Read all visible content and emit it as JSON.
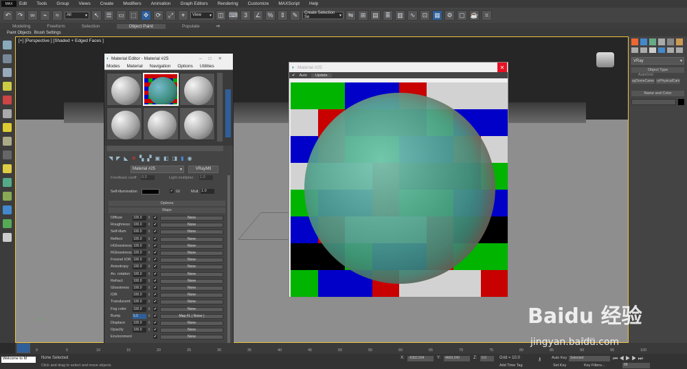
{
  "menubar": {
    "logo": "MAX",
    "items": [
      "Edit",
      "Tools",
      "Group",
      "Views",
      "Create",
      "Modifiers",
      "Animation",
      "Graph Editors",
      "Rendering",
      "Customize",
      "MAXScript",
      "Help"
    ]
  },
  "toolbar": {
    "filter_select": "All",
    "view_select": "View",
    "named_selection": "Create Selection Se"
  },
  "ribbon": {
    "tabs": [
      "Modeling",
      "Freeform",
      "Selection",
      "Object Paint",
      "Populate"
    ],
    "active": "Object Paint",
    "sub": [
      "Paint Objects",
      "Brush Settings"
    ]
  },
  "viewport": {
    "label": "[+] [Perspective ] [Shaded + Edged Faces ]"
  },
  "material_editor": {
    "title": "Material Editor - Material #25",
    "menus": [
      "Modes",
      "Material",
      "Navigation",
      "Options",
      "Utilities"
    ],
    "material_name": "Material #25",
    "material_type": "VRayMtl",
    "fresnel_label": "Feedback coeff",
    "fresnel_value": "0.0",
    "light_mult_label": "Light multiplier",
    "light_mult_value": "1.0",
    "self_illum_label": "Self-illumination",
    "gi_label": "GI",
    "mult_label": "Mult",
    "mult_value": "1.0",
    "options_rollout": "Options",
    "maps_rollout": "Maps",
    "maps": [
      {
        "name": "Diffuse",
        "value": "100.0",
        "map": "None"
      },
      {
        "name": "Roughness",
        "value": "100.0",
        "map": "None"
      },
      {
        "name": "Self-illum",
        "value": "100.0",
        "map": "None"
      },
      {
        "name": "Reflect",
        "value": "100.0",
        "map": "None"
      },
      {
        "name": "HGlossiness",
        "value": "100.0",
        "map": "None"
      },
      {
        "name": "RGlossiness",
        "value": "100.0",
        "map": "None"
      },
      {
        "name": "Fresnel IOR",
        "value": "100.0",
        "map": "None"
      },
      {
        "name": "Anisotropy",
        "value": "100.0",
        "map": "None"
      },
      {
        "name": "An. rotation",
        "value": "100.0",
        "map": "None"
      },
      {
        "name": "Refract",
        "value": "100.0",
        "map": "None"
      },
      {
        "name": "Glossiness",
        "value": "100.0",
        "map": "None"
      },
      {
        "name": "IOR",
        "value": "100.0",
        "map": "None"
      },
      {
        "name": "Translucent",
        "value": "100.0",
        "map": "None"
      },
      {
        "name": "Fog color",
        "value": "100.0",
        "map": "None"
      },
      {
        "name": "Bump",
        "value": "5.0",
        "map": "Map #1 ( Noise )"
      },
      {
        "name": "Displace",
        "value": "100.0",
        "map": "None"
      },
      {
        "name": "Opacity",
        "value": "100.0",
        "map": "None"
      },
      {
        "name": "Environment",
        "value": "",
        "map": "None"
      }
    ]
  },
  "preview_window": {
    "title": "Material #25",
    "auto_label": "Auto",
    "update_label": "Update",
    "close_glyph": "✕"
  },
  "command_panel": {
    "renderer": "VRay",
    "object_type_header": "Object Type",
    "autogrid": "AutoGrid",
    "btn1": "ayDomeCame",
    "btn2": "ryPhysicalCam",
    "name_color_header": "Name and Color"
  },
  "timeline": {
    "frame": "0 / 100",
    "ticks": [
      "0",
      "5",
      "10",
      "15",
      "20",
      "25",
      "30",
      "35",
      "40",
      "45",
      "50",
      "55",
      "60",
      "65",
      "70",
      "75",
      "80",
      "85",
      "90",
      "95",
      "100"
    ]
  },
  "status": {
    "maxscript": "Welcome to M",
    "selection": "None Selected",
    "prompt": "Click and drag to select and move objects",
    "x_label": "X:",
    "x_value": "-6362.594",
    "y_label": "Y:",
    "y_value": "4669.240",
    "z_label": "Z:",
    "z_value": "0.0",
    "grid": "Grid = 10.0",
    "add_time_tag": "Add Time Tag",
    "auto_key": "Auto Key",
    "selected": "Selected",
    "set_key": "Set Key",
    "key_filters": "Key Filters...",
    "frame_field": "88"
  },
  "watermark": {
    "brand": "Baidu 经验",
    "url": "jingyan.baidu.com"
  }
}
